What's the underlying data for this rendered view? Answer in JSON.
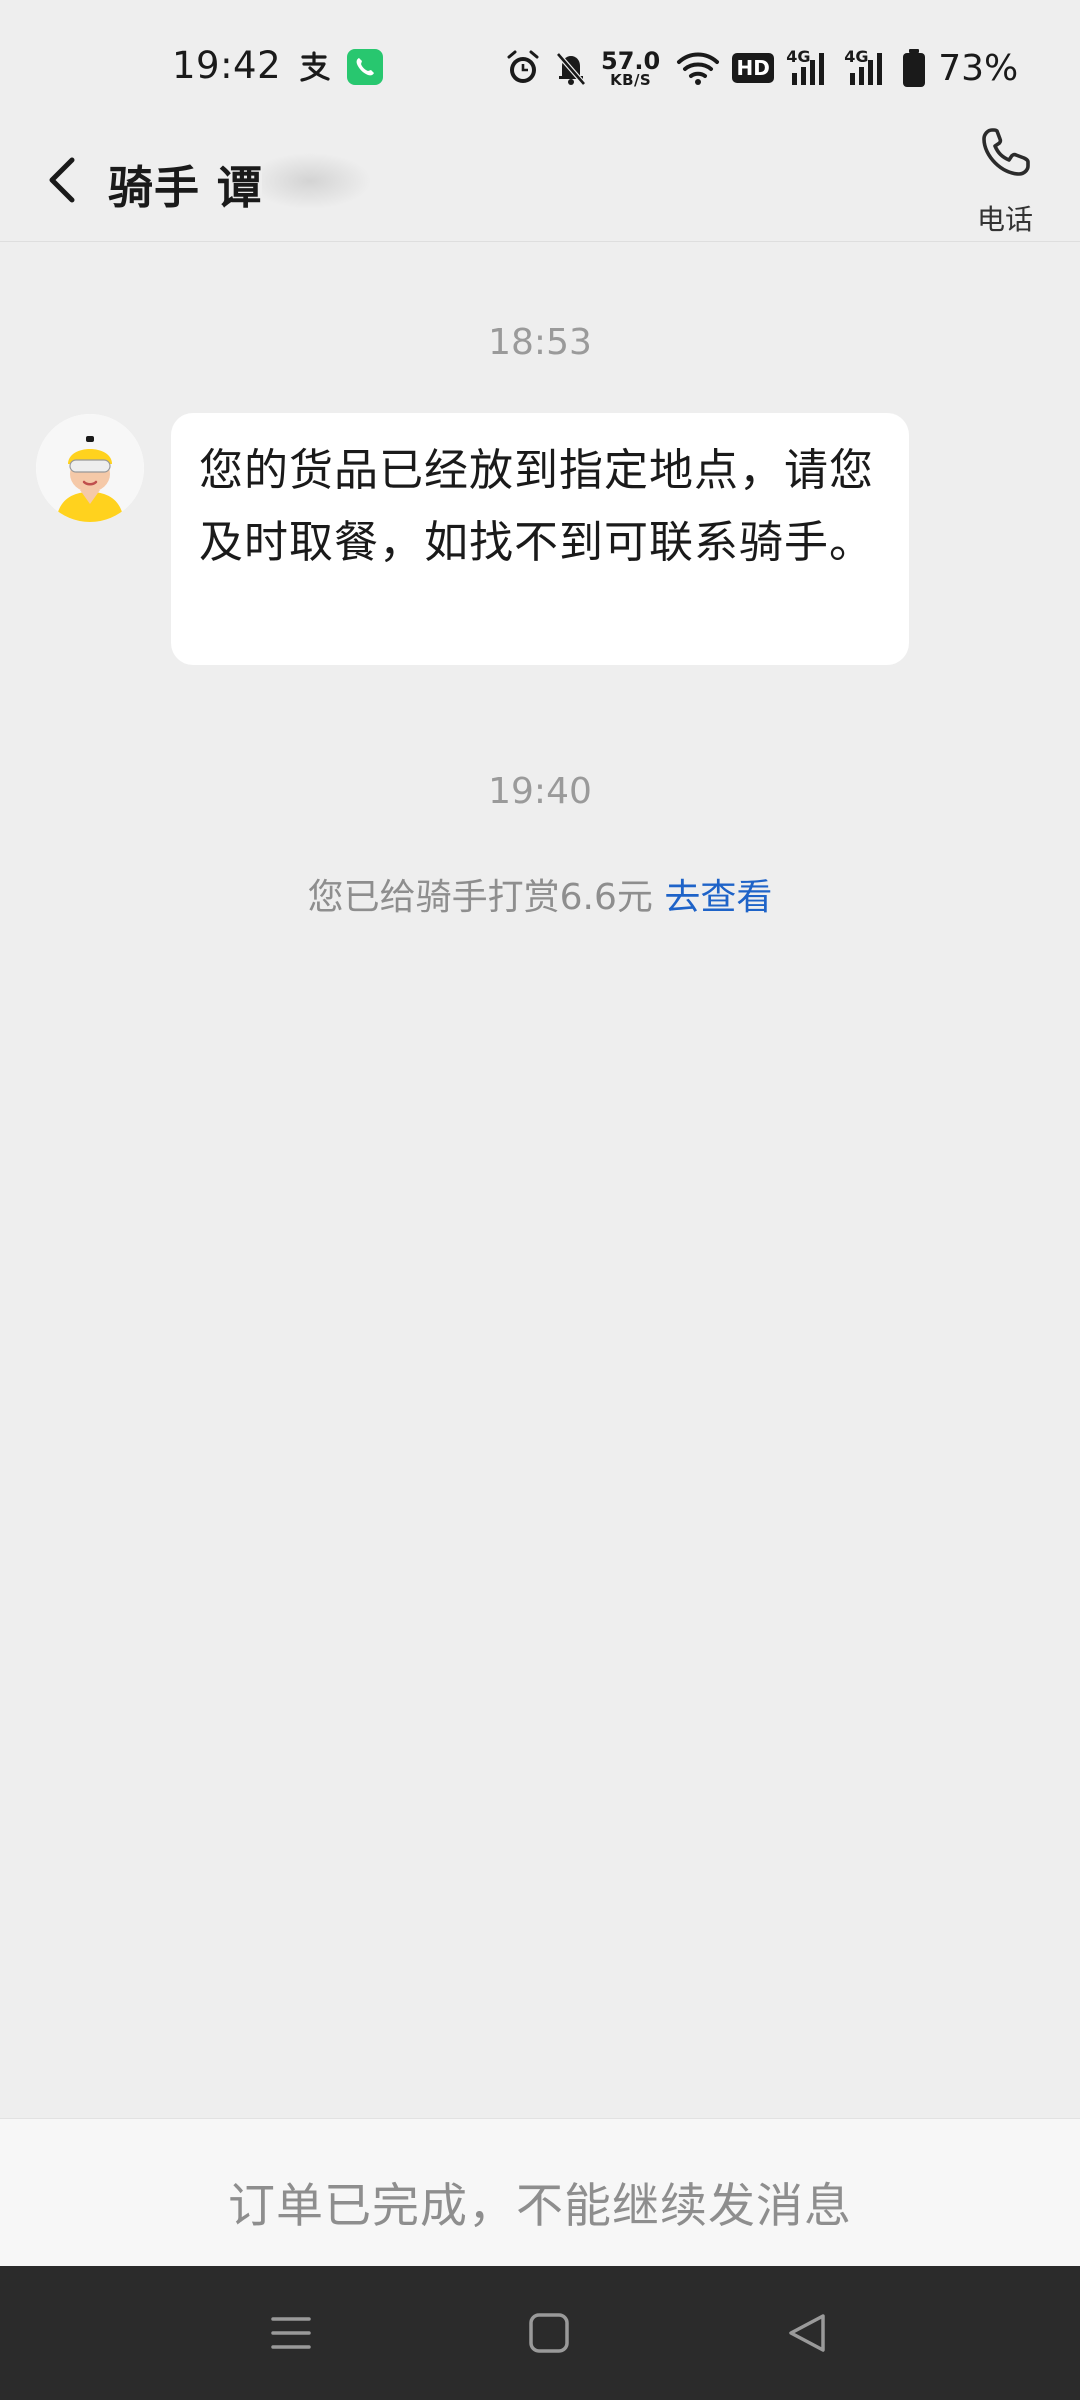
{
  "status_bar": {
    "time": "19:42",
    "network_speed": "57.0",
    "network_speed_unit": "KB/S",
    "hd_label": "HD",
    "signal_1_label": "4G",
    "signal_2_label": "4G",
    "battery_percent": "73%",
    "icons": [
      "alipay-icon",
      "call-active-icon",
      "alarm-icon",
      "mute-icon",
      "wifi-icon",
      "hd-icon",
      "signal-icon",
      "signal-icon",
      "battery-icon"
    ]
  },
  "header": {
    "title": "骑手 谭",
    "phone_label": "电话"
  },
  "chat": {
    "timestamp_1": "18:53",
    "message_1": "您的货品已经放到指定地点，请您及时取餐，如找不到可联系骑手。",
    "timestamp_2": "19:40",
    "tip_text": "您已给骑手打赏6.6元",
    "tip_link": "去查看"
  },
  "footer": {
    "notice": "订单已完成，不能继续发消息"
  },
  "colors": {
    "background": "#eeeeee",
    "bubble": "#ffffff",
    "link": "#1e63c8",
    "muted_text": "#8e8e8e",
    "nav_bar": "#2b2b2b",
    "call_green": "#28c76f",
    "avatar_helmet": "#ffd21e"
  }
}
